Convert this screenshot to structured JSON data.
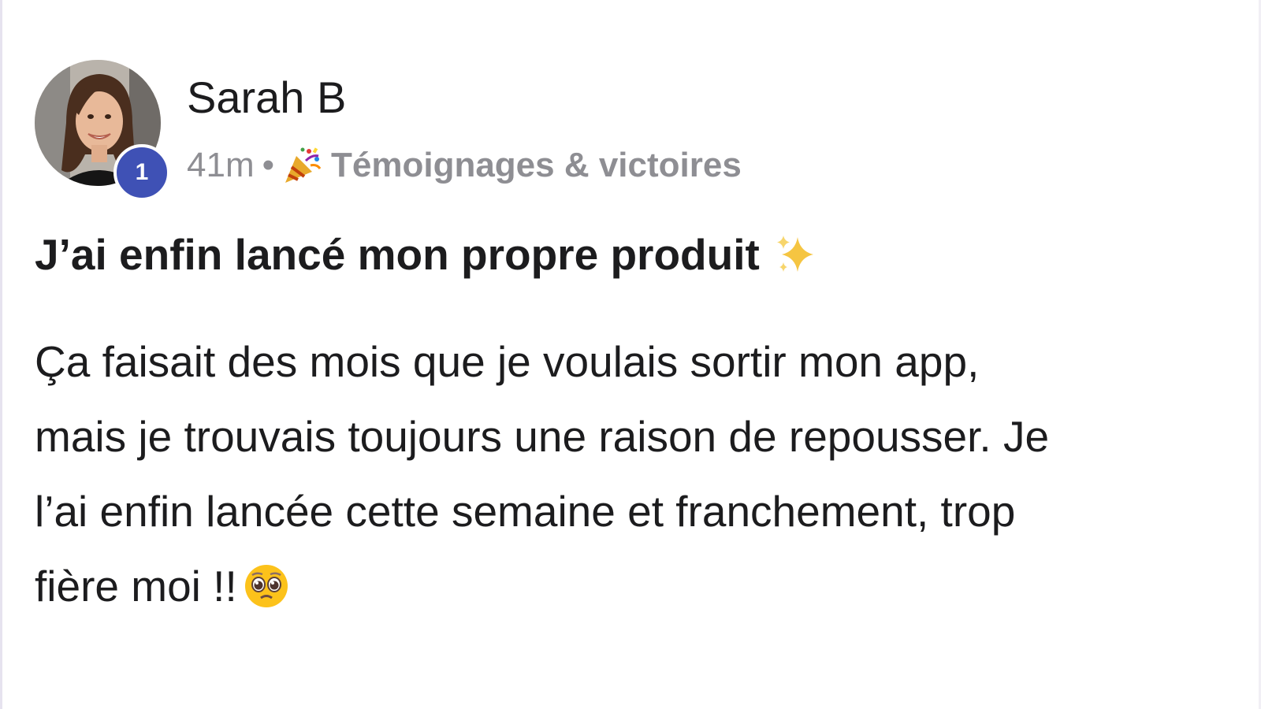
{
  "post": {
    "author": {
      "name": "Sarah B",
      "level": "1",
      "avatar_icon": "avatar-photo-icon"
    },
    "meta": {
      "time": "41m",
      "separator": "•",
      "category_icon": "party-popper-icon",
      "category": "Témoignages & victoires"
    },
    "title": "J’ai enfin lancé mon propre produit",
    "title_icon": "sparkles-icon",
    "body_lines": [
      "Ça faisait des mois que je voulais sortir mon app,",
      "mais je trouvais toujours une raison de repousser. Je",
      "l’ai enfin lancée cette semaine et franchement, trop",
      "fière moi !!"
    ],
    "body_end_icon": "pleading-face-icon"
  },
  "colors": {
    "badge": "#3f51b5",
    "meta_text": "#8e8e93",
    "text": "#1c1c1e"
  }
}
